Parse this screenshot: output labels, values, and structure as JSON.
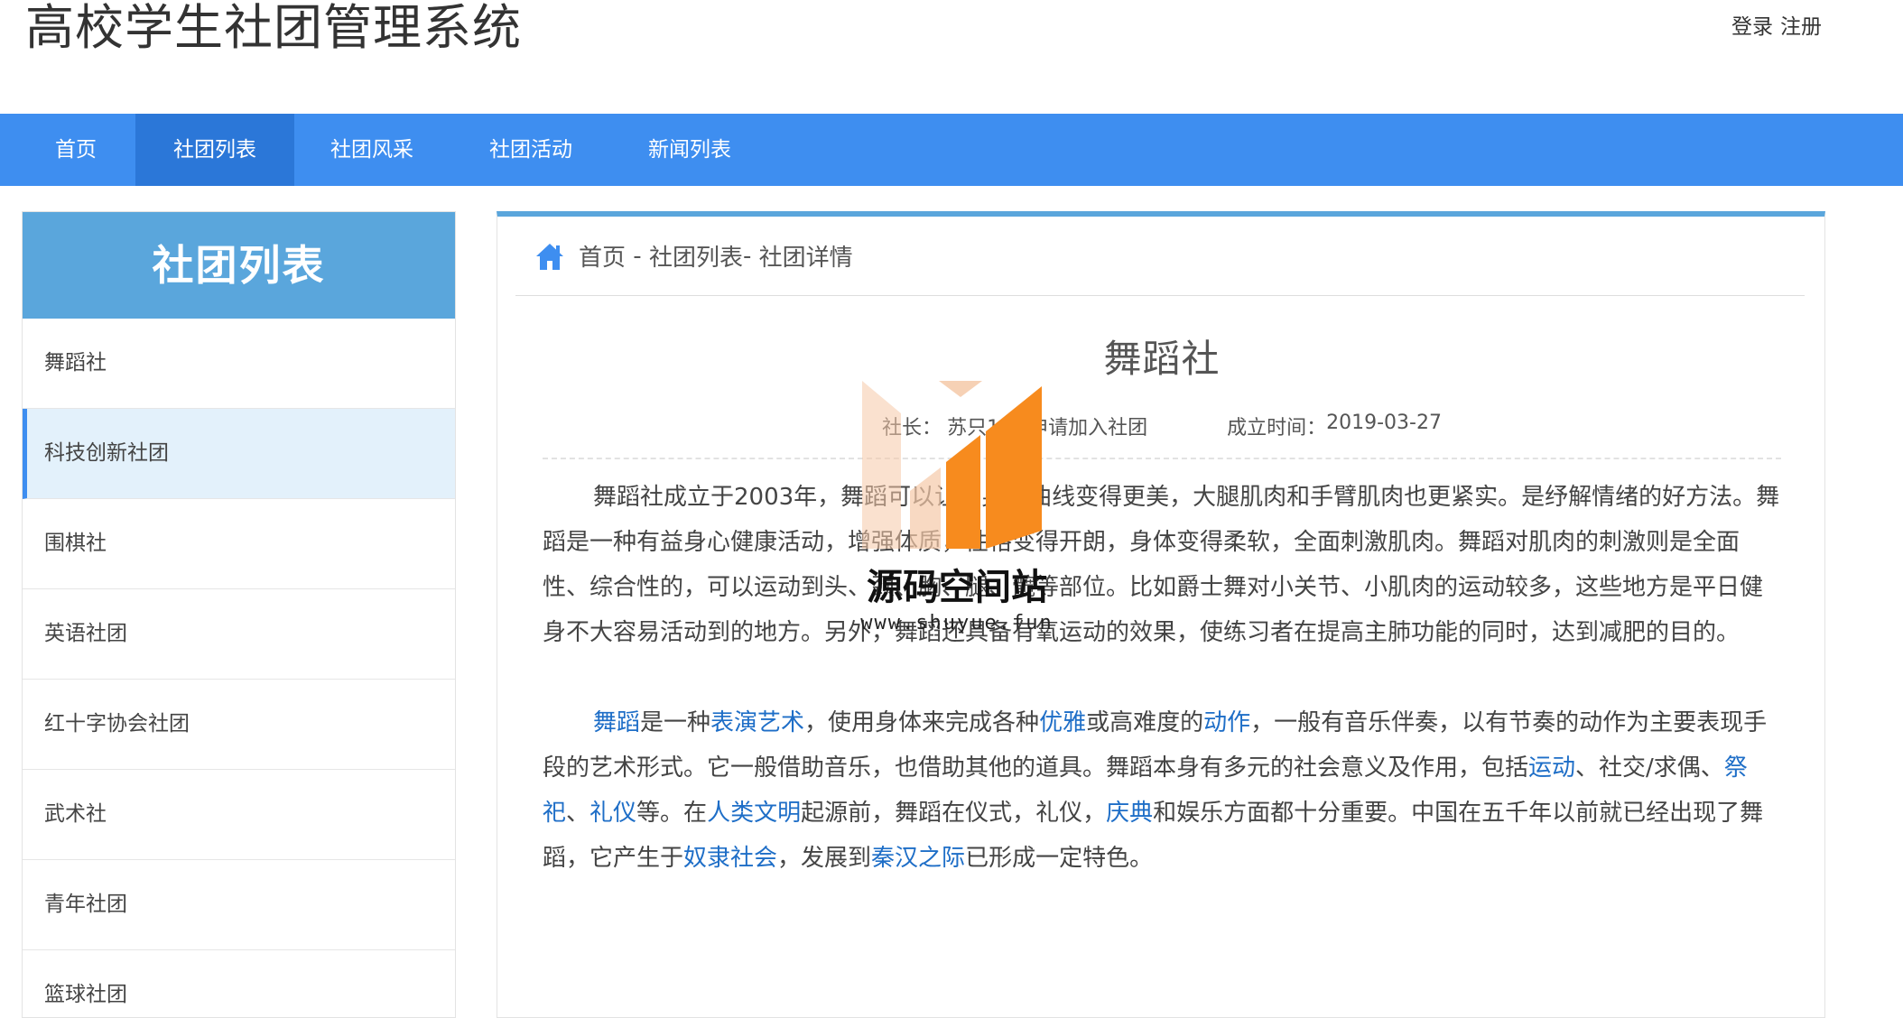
{
  "header": {
    "site_title": "高校学生社团管理系统",
    "login_label": "登录",
    "register_label": "注册"
  },
  "nav": {
    "items": [
      {
        "label": "首页"
      },
      {
        "label": "社团列表"
      },
      {
        "label": "社团风采"
      },
      {
        "label": "社团活动"
      },
      {
        "label": "新闻列表"
      }
    ],
    "active": "社团列表"
  },
  "sidebar": {
    "title": "社团列表",
    "items": [
      {
        "label": "舞蹈社"
      },
      {
        "label": "科技创新社团"
      },
      {
        "label": "围棋社"
      },
      {
        "label": "英语社团"
      },
      {
        "label": "红十字协会社团"
      },
      {
        "label": "武术社"
      },
      {
        "label": "青年社团"
      },
      {
        "label": "篮球社团"
      }
    ],
    "active": "科技创新社团"
  },
  "breadcrumb": {
    "home": "首页",
    "sep1": " - ",
    "list": "社团列表",
    "sep2": "- ",
    "current": "社团详情"
  },
  "club": {
    "name": "舞蹈社",
    "leader_label": "社长：",
    "leader_name": "苏只1",
    "join_label": "申请加入社团",
    "founded_label": "成立时间：",
    "founded_date": "2019-03-27"
  },
  "article": {
    "paragraph1": "舞蹈社成立于2003年，舞蹈可以让人身材曲线变得更美，大腿肌肉和手臂肌肉也更紧实。是纾解情绪的好方法。舞蹈是一种有益身心健康活动，增强体质，性格变得开朗，身体变得柔软，全面刺激肌肉。舞蹈对肌肉的刺激则是全面性、综合性的，可以运动到头、颈、胸、腿、髋等部位。比如爵士舞对小关节、小肌肉的运动较多，这些地方是平日健身不大容易活动到的地方。另外，舞蹈还具备有氧运动的效果，使练习者在提高主肺功能的同时，达到减肥的目的。",
    "p2": [
      {
        "text": "舞蹈",
        "link": true
      },
      {
        "text": "是一种",
        "link": false
      },
      {
        "text": "表演艺术",
        "link": true
      },
      {
        "text": "，使用身体来完成各种",
        "link": false
      },
      {
        "text": "优雅",
        "link": true
      },
      {
        "text": "或高难度的",
        "link": false
      },
      {
        "text": "动作",
        "link": true
      },
      {
        "text": "，一般有音乐伴奏，以有节奏的动作为主要表现手段的艺术形式。它一般借助音乐，也借助其他的道具。舞蹈本身有多元的社会意义及作用，包括",
        "link": false
      },
      {
        "text": "运动",
        "link": true
      },
      {
        "text": "、社交/求偶、",
        "link": false
      },
      {
        "text": "祭祀",
        "link": true
      },
      {
        "text": "、",
        "link": false
      },
      {
        "text": "礼仪",
        "link": true
      },
      {
        "text": "等。在",
        "link": false
      },
      {
        "text": "人类文明",
        "link": true
      },
      {
        "text": "起源前，舞蹈在仪式，礼仪，",
        "link": false
      },
      {
        "text": "庆典",
        "link": true
      },
      {
        "text": "和娱乐方面都十分重要。中国在五千年以前就已经出现了舞蹈，它产生于",
        "link": false
      },
      {
        "text": "奴隶社会",
        "link": true
      },
      {
        "text": "，发展到",
        "link": false
      },
      {
        "text": "秦汉之际",
        "link": true
      },
      {
        "text": "已形成一定特色。",
        "link": false
      }
    ]
  },
  "watermark": {
    "title": "源码空间站",
    "url": "www.shuyue.fun"
  },
  "colors": {
    "nav_bg": "#3e8ef0",
    "nav_active_bg": "#2b77d8",
    "sidebar_head_bg": "#5aa6dc",
    "sidebar_active_bg": "#e3f1fb",
    "link": "#1e6ec7",
    "watermark_orange": "#f78b1e"
  }
}
